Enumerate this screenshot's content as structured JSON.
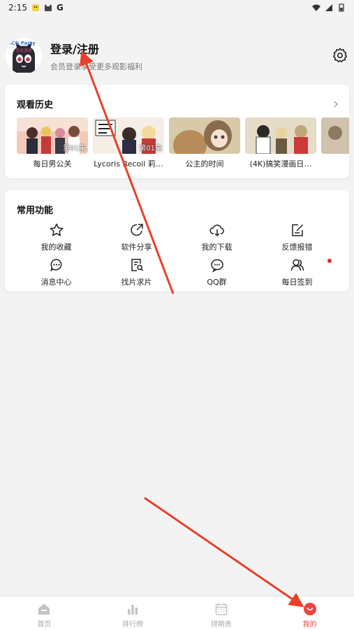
{
  "status_bar": {
    "time": "2:15",
    "g_letter": "G"
  },
  "profile": {
    "title": "登录/注册",
    "subtitle": "会员登录享受更多观影福利",
    "avatar_text": [
      "ACG Party",
      "次元派对"
    ]
  },
  "history": {
    "title": "观看历史",
    "items": [
      {
        "title": "每日男公关",
        "badge": "第01集"
      },
      {
        "title": "Lycoris Recoil 莉…",
        "badge": "第01集"
      },
      {
        "title": "公主的时间",
        "badge": ""
      },
      {
        "title": "(4K)搞笑漫画日…",
        "badge": ""
      },
      {
        "title": "(",
        "badge": ""
      }
    ]
  },
  "features": {
    "title": "常用功能",
    "items": [
      {
        "label": "我的收藏",
        "icon": "star-icon"
      },
      {
        "label": "软件分享",
        "icon": "share-icon"
      },
      {
        "label": "我的下载",
        "icon": "cloud-download-icon"
      },
      {
        "label": "反馈报错",
        "icon": "edit-icon"
      },
      {
        "label": "消息中心",
        "icon": "message-icon"
      },
      {
        "label": "找片求片",
        "icon": "search-doc-icon"
      },
      {
        "label": "QQ群",
        "icon": "chat-icon"
      },
      {
        "label": "每日签到",
        "icon": "users-icon"
      }
    ]
  },
  "nav": {
    "items": [
      {
        "label": "首页",
        "icon": "home-icon"
      },
      {
        "label": "排行榜",
        "icon": "bar-chart-icon"
      },
      {
        "label": "排期表",
        "icon": "calendar-icon"
      },
      {
        "label": "我的",
        "icon": "profile-smile-icon"
      }
    ],
    "active_color": "#e9473f",
    "inactive_color": "#aaaaaa"
  },
  "annotation_color": "#e8402a"
}
